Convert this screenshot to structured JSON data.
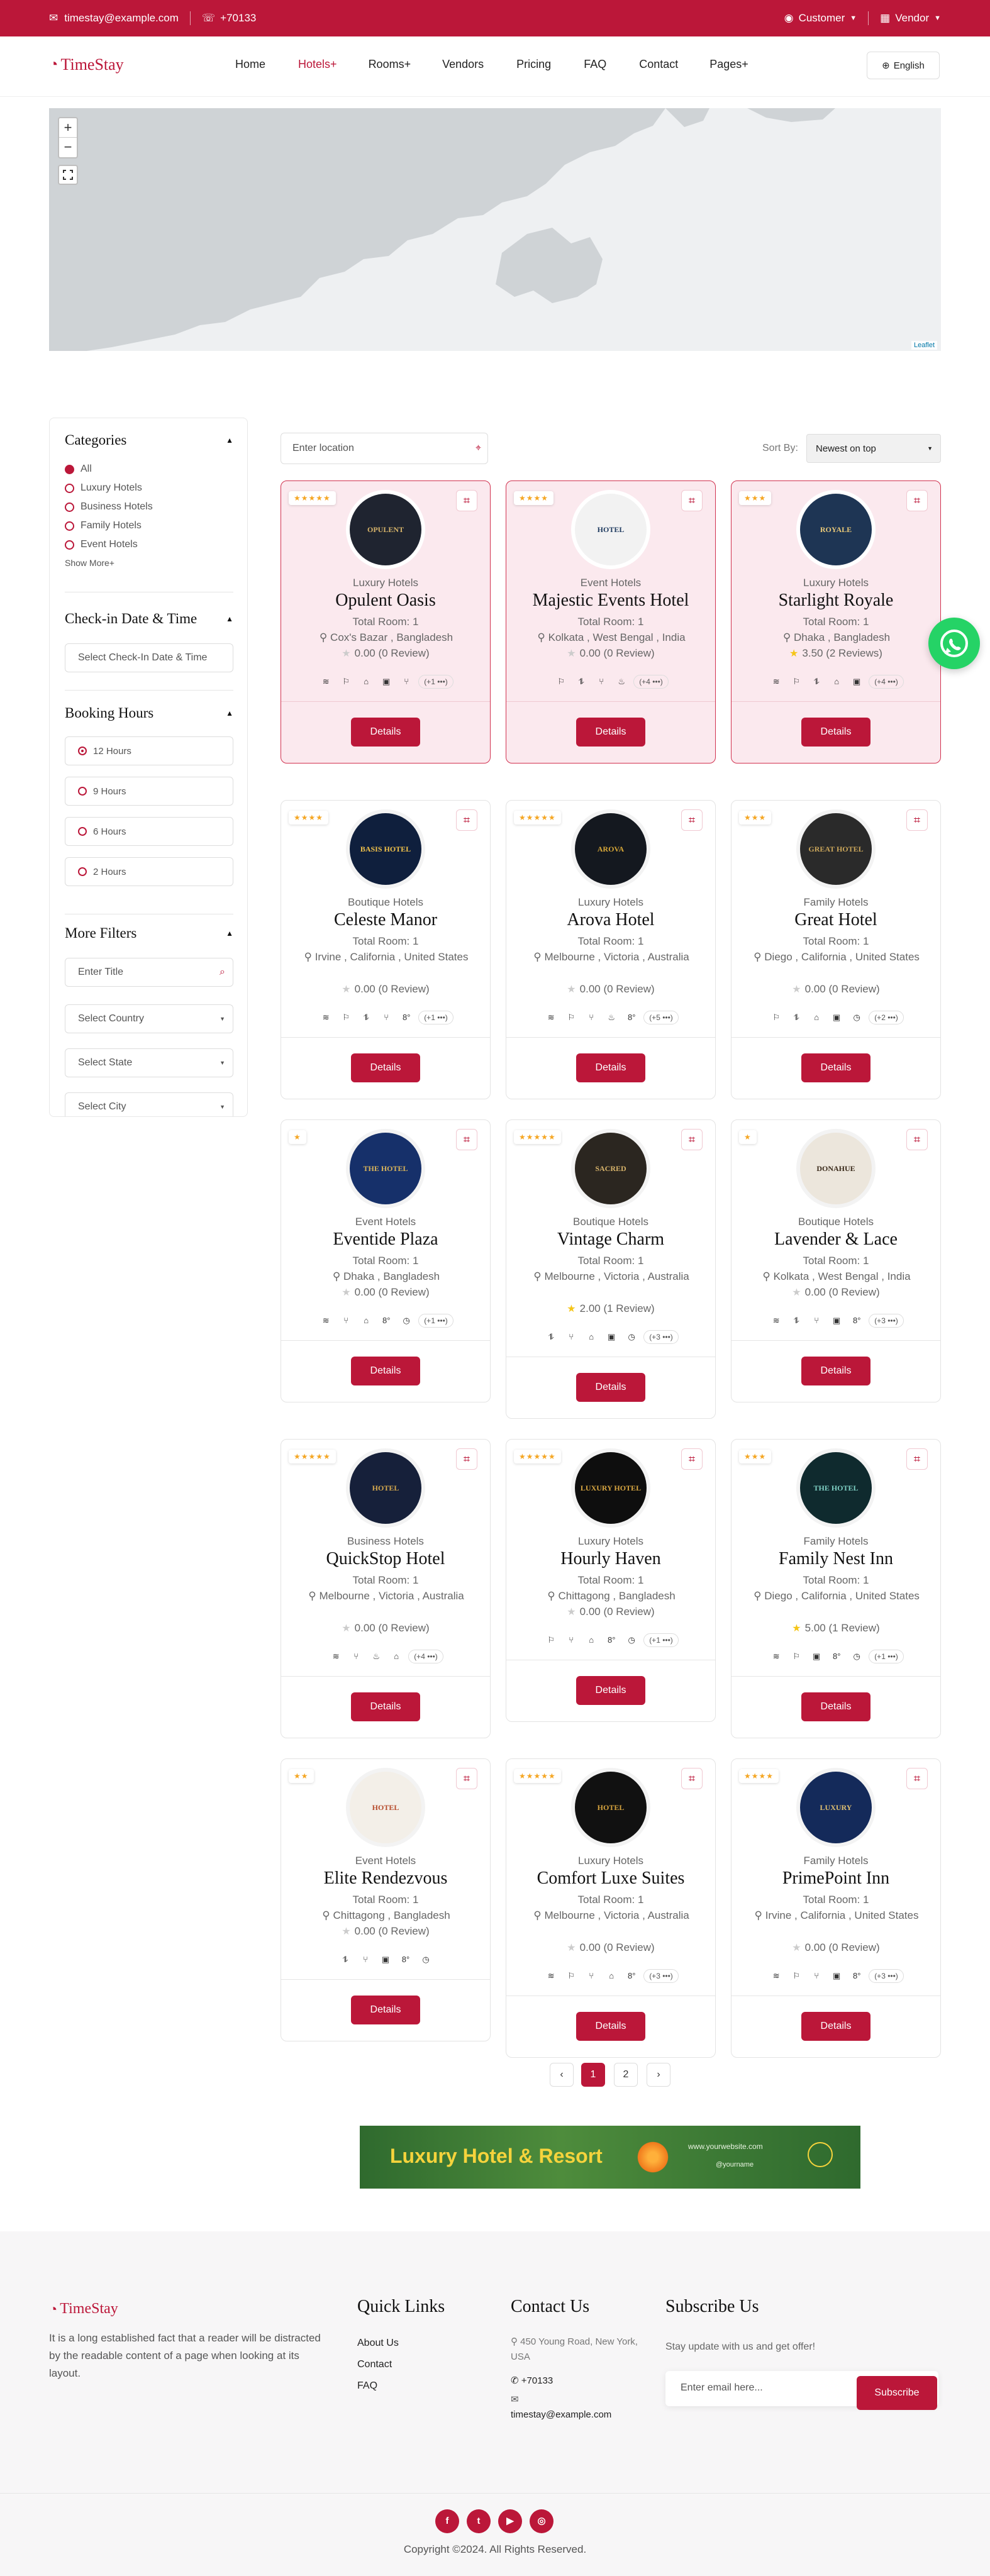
{
  "topbar": {
    "email": "timestay@example.com",
    "phone": "+70133",
    "customer": "Customer",
    "vendor": "Vendor"
  },
  "nav": {
    "logo": "TimeStay",
    "items": [
      "Home",
      "Hotels+",
      "Rooms+",
      "Vendors",
      "Pricing",
      "FAQ",
      "Contact",
      "Pages+"
    ],
    "language": "English"
  },
  "map": {
    "zoom_in": "+",
    "zoom_out": "−",
    "attribution": "Leaflet"
  },
  "sidebar": {
    "categories_title": "Categories",
    "categories": [
      "All",
      "Luxury Hotels",
      "Business Hotels",
      "Family Hotels",
      "Event Hotels"
    ],
    "show_more": "Show More+",
    "checkin_title": "Check-in Date & Time",
    "checkin_placeholder": "Select Check-In Date & Time",
    "booking_title": "Booking Hours",
    "hours": [
      "12 Hours",
      "9 Hours",
      "6 Hours",
      "2 Hours"
    ],
    "filters_title": "More Filters",
    "title_placeholder": "Enter Title",
    "country": "Select Country",
    "state": "Select State",
    "city": "Select City"
  },
  "toolbar": {
    "location_placeholder": "Enter location",
    "sort_label": "Sort By:",
    "sort_value": "Newest on top"
  },
  "labels": {
    "details": "Details"
  },
  "hotels": [
    {
      "stars": "★★★★★",
      "type": "Luxury Hotels",
      "name": "Opulent Oasis",
      "rooms": "Total Room: 1",
      "location": "Cox's Bazar , Bangladesh",
      "rating": "0.00 (0 Review)",
      "more": "(+1 •••)",
      "logo_text": "OPULENT",
      "logo_bg": "#1f2430",
      "logo_fg": "#d7b46a"
    },
    {
      "stars": "★★★★",
      "type": "Event Hotels",
      "name": "Majestic Events Hotel",
      "rooms": "Total Room: 1",
      "location": "Kolkata , West Bengal , India",
      "rating": "0.00 (0 Review)",
      "more": "(+4 •••)",
      "logo_text": "HOTEL",
      "logo_bg": "#f2f2f2",
      "logo_fg": "#1e3a5f"
    },
    {
      "stars": "★★★",
      "type": "Luxury Hotels",
      "name": "Starlight Royale",
      "rooms": "Total Room: 1",
      "location": "Dhaka , Bangladesh",
      "rating": "3.50 (2 Reviews)",
      "more": "(+4 •••)",
      "logo_text": "ROYALE",
      "logo_bg": "#1e3554",
      "logo_fg": "#e8c878"
    },
    {
      "stars": "★★★★",
      "type": "Boutique Hotels",
      "name": "Celeste Manor",
      "rooms": "Total Room: 1",
      "location": "Irvine , California , United States",
      "rating": "0.00 (0 Review)",
      "more": "(+1 •••)",
      "logo_text": "BASIS HOTEL",
      "logo_bg": "#0f1f3d",
      "logo_fg": "#f3c34a"
    },
    {
      "stars": "★★★★★",
      "type": "Luxury Hotels",
      "name": "Arova Hotel",
      "rooms": "Total Room: 1",
      "location": "Melbourne , Victoria , Australia",
      "rating": "0.00 (0 Review)",
      "more": "(+5 •••)",
      "logo_text": "AROVA",
      "logo_bg": "#14181f",
      "logo_fg": "#d8a838"
    },
    {
      "stars": "★★★",
      "type": "Family Hotels",
      "name": "Great Hotel",
      "rooms": "Total Room: 1",
      "location": "Diego , California , United States",
      "rating": "0.00 (0 Review)",
      "more": "(+2 •••)",
      "logo_text": "GREAT HOTEL",
      "logo_bg": "#2a2a2a",
      "logo_fg": "#c9a55a"
    },
    {
      "stars": "★",
      "type": "Event Hotels",
      "name": "Eventide Plaza",
      "rooms": "Total Room: 1",
      "location": "Dhaka , Bangladesh",
      "rating": "0.00 (0 Review)",
      "more": "(+1 •••)",
      "logo_text": "THE HOTEL",
      "logo_bg": "#16306a",
      "logo_fg": "#d9b45a"
    },
    {
      "stars": "★★★★★",
      "type": "Boutique Hotels",
      "name": "Vintage Charm",
      "rooms": "Total Room: 1",
      "location": "Melbourne , Victoria , Australia",
      "rating": "2.00 (1 Review)",
      "more": "(+3 •••)",
      "logo_text": "SACRED",
      "logo_bg": "#2b2620",
      "logo_fg": "#d6b26a"
    },
    {
      "stars": "★",
      "type": "Boutique Hotels",
      "name": "Lavender & Lace",
      "rooms": "Total Room: 1",
      "location": "Kolkata , West Bengal , India",
      "rating": "0.00 (0 Review)",
      "more": "(+3 •••)",
      "logo_text": "DONAHUE",
      "logo_bg": "#ece6dc",
      "logo_fg": "#3a2a1a"
    },
    {
      "stars": "★★★★★",
      "type": "Business Hotels",
      "name": "QuickStop Hotel",
      "rooms": "Total Room: 1",
      "location": "Melbourne , Victoria , Australia",
      "rating": "0.00 (0 Review)",
      "more": "(+4 •••)",
      "logo_text": "HOTEL",
      "logo_bg": "#16203a",
      "logo_fg": "#d7aa4e"
    },
    {
      "stars": "★★★★★",
      "type": "Luxury Hotels",
      "name": "Hourly Haven",
      "rooms": "Total Room: 1",
      "location": "Chittagong , Bangladesh",
      "rating": "0.00 (0 Review)",
      "more": "(+1 •••)",
      "logo_text": "LUXURY HOTEL",
      "logo_bg": "#0e0e0e",
      "logo_fg": "#d9a741"
    },
    {
      "stars": "★★★",
      "type": "Family Hotels",
      "name": "Family Nest Inn",
      "rooms": "Total Room: 1",
      "location": "Diego , California , United States",
      "rating": "5.00 (1 Review)",
      "more": "(+1 •••)",
      "logo_text": "THE HOTEL",
      "logo_bg": "#0f2a2e",
      "logo_fg": "#7fd0c4"
    },
    {
      "stars": "★★",
      "type": "Event Hotels",
      "name": "Elite Rendezvous",
      "rooms": "Total Room: 1",
      "location": "Chittagong , Bangladesh",
      "rating": "0.00 (0 Review)",
      "more": "",
      "logo_text": "HOTEL",
      "logo_bg": "#f3efe8",
      "logo_fg": "#b54a2a"
    },
    {
      "stars": "★★★★★",
      "type": "Luxury Hotels",
      "name": "Comfort Luxe Suites",
      "rooms": "Total Room: 1",
      "location": "Melbourne , Victoria , Australia",
      "rating": "0.00 (0 Review)",
      "more": "(+3 •••)",
      "logo_text": "HOTEL",
      "logo_bg": "#111111",
      "logo_fg": "#d7a43e"
    },
    {
      "stars": "★★★★",
      "type": "Family Hotels",
      "name": "PrimePoint Inn",
      "rooms": "Total Room: 1",
      "location": "Irvine , California , United States",
      "rating": "0.00 (0 Review)",
      "more": "(+3 •••)",
      "logo_text": "LUXURY",
      "logo_bg": "#142a5a",
      "logo_fg": "#e0c070"
    }
  ],
  "pagination": {
    "prev": "‹",
    "pages": [
      "1",
      "2"
    ],
    "next": "›"
  },
  "banner": {
    "title": "Luxury Hotel & Resort",
    "site": "www.yourwebsite.com",
    "handle": "@yourname"
  },
  "footer": {
    "logo": "TimeStay",
    "about": "It is a long established fact that a reader will be distracted by the readable content of a page when looking at its layout.",
    "quick_title": "Quick Links",
    "links": [
      "About Us",
      "Contact",
      "FAQ"
    ],
    "contact_title": "Contact Us",
    "address": "450 Young Road, New York, USA",
    "phone": "+70133",
    "email": "timestay@example.com",
    "subscribe_title": "Subscribe Us",
    "subscribe_text": "Stay update with us and get offer!",
    "email_placeholder": "Enter email here...",
    "subscribe_btn": "Subscribe",
    "social": [
      "f",
      "t",
      "▶",
      "◎"
    ],
    "copyright": "Copyright ©2024. All Rights Reserved."
  }
}
